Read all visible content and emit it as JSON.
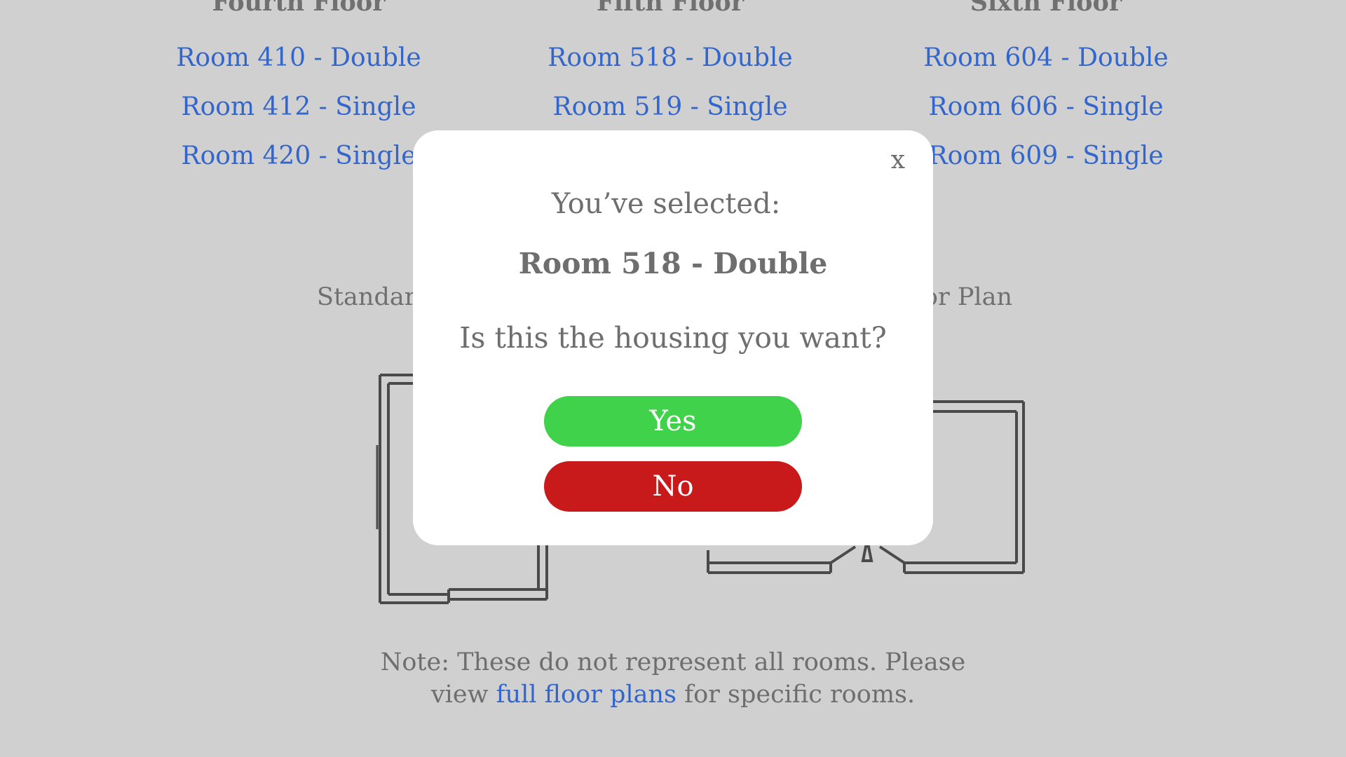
{
  "floors": [
    {
      "heading": "Fourth Floor",
      "rooms": [
        "Room 410 - Double",
        "Room 412 - Single",
        "Room 420 - Single"
      ]
    },
    {
      "heading": "Fifth Floor",
      "rooms": [
        "Room 518 - Double",
        "Room 519 - Single"
      ]
    },
    {
      "heading": "Sixth Floor",
      "rooms": [
        "Room 604 - Double",
        "Room 606 - Single",
        "Room 609 - Single"
      ]
    }
  ],
  "plans": {
    "left_label": "Standard",
    "right_label": "or Plan"
  },
  "note": {
    "text_before": "Note: These do not represent all rooms. Please view ",
    "link": "full floor plans",
    "text_after": " for specific rooms."
  },
  "modal": {
    "close": "x",
    "selected_label": "You’ve selected:",
    "room": "Room 518 - Double",
    "question": "Is this the housing you want?",
    "yes_label": "Yes",
    "no_label": "No"
  },
  "colors": {
    "background": "#d0d0d0",
    "link": "#3366cc",
    "yes": "#41d24b",
    "no": "#c8191b"
  }
}
